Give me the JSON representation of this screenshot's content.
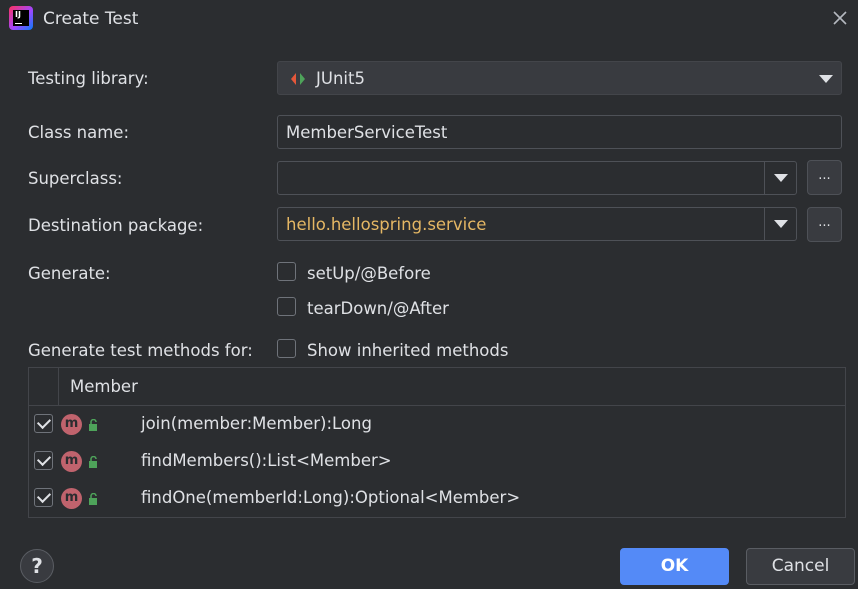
{
  "window": {
    "title": "Create Test"
  },
  "form": {
    "testing_library": {
      "label": "Testing library:",
      "value": "JUnit5"
    },
    "class_name": {
      "label": "Class name:",
      "value": "MemberServiceTest"
    },
    "superclass": {
      "label": "Superclass:",
      "value": "",
      "browse": "..."
    },
    "destination": {
      "label": "Destination package:",
      "value": "hello.hellospring.service",
      "browse": "..."
    },
    "generate": {
      "label": "Generate:",
      "options": [
        {
          "label": "setUp/@Before",
          "checked": false
        },
        {
          "label": "tearDown/@After",
          "checked": false
        }
      ]
    },
    "methods_for": {
      "label": "Generate test methods for:",
      "show_inherited": "Show inherited methods"
    }
  },
  "table": {
    "header": "Member",
    "rows": [
      {
        "icon": "m",
        "method": "join(member:Member):Long",
        "checked": true
      },
      {
        "icon": "m",
        "method": "findMembers():List<Member>",
        "checked": true
      },
      {
        "icon": "m",
        "method": "findOne(memberId:Long):Optional<Member>",
        "checked": true
      }
    ]
  },
  "footer": {
    "help": "?",
    "ok": "OK",
    "cancel": "Cancel"
  },
  "colors": {
    "accent": "#548af7",
    "package_text": "#e5b764",
    "method_icon": "#c0636d",
    "lock_icon": "#4ea35a"
  },
  "icons": {
    "app": "intellij-icon",
    "close": "close-icon",
    "junit": "junit-icon",
    "method": "method-icon",
    "lock": "unlock-icon",
    "help": "help-icon"
  }
}
